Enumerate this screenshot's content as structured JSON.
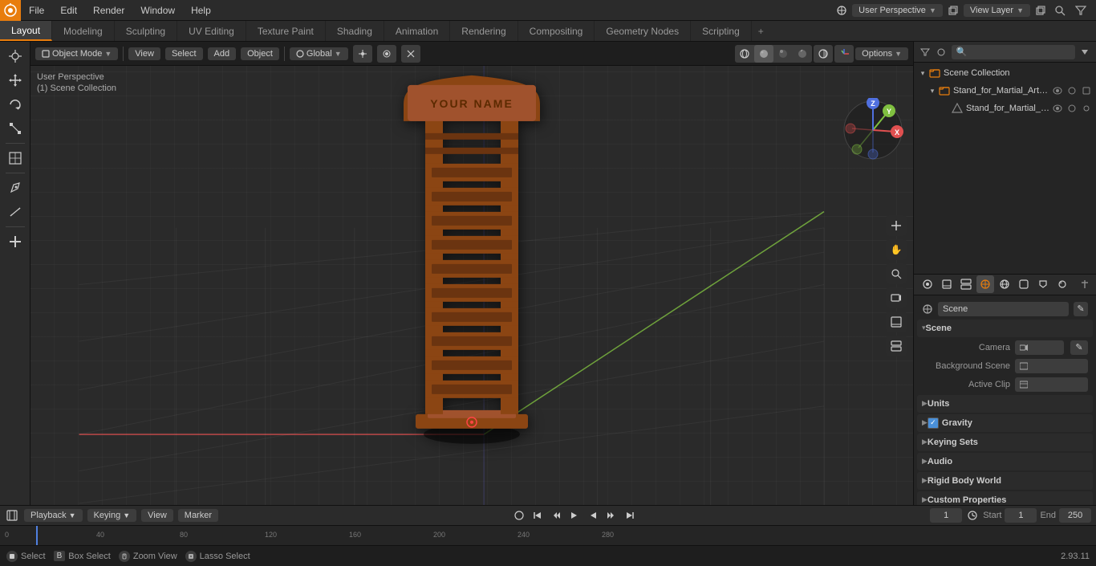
{
  "app": {
    "title": "Blender",
    "version": "2.93.11"
  },
  "top_menu": {
    "logo": "B",
    "items": [
      "File",
      "Edit",
      "Render",
      "Window",
      "Help"
    ]
  },
  "workspace_tabs": {
    "tabs": [
      "Layout",
      "Modeling",
      "Sculpting",
      "UV Editing",
      "Texture Paint",
      "Shading",
      "Animation",
      "Rendering",
      "Compositing",
      "Geometry Nodes",
      "Scripting"
    ],
    "active": "Layout",
    "plus_icon": "+"
  },
  "viewport": {
    "mode_label": "Object Mode",
    "view_label": "View",
    "select_label": "Select",
    "add_label": "Add",
    "object_label": "Object",
    "transform_label": "Global",
    "options_label": "Options",
    "overlay_label": "User Perspective",
    "collection_label": "(1) Scene Collection"
  },
  "scene_object": {
    "name": "Stand_for_Martial_Art_Belts",
    "text": "YOUR NAME"
  },
  "outliner": {
    "title": "Scene Collection",
    "search_placeholder": "",
    "items": [
      {
        "name": "Scene Collection",
        "type": "collection",
        "icon": "📁",
        "expanded": true,
        "depth": 0,
        "has_expand": true
      },
      {
        "name": "Stand_for_Martial_Art_Belts_C",
        "type": "mesh",
        "icon": "▷",
        "expanded": true,
        "depth": 1,
        "has_expand": true,
        "selected": false
      },
      {
        "name": "Stand_for_Martial_Art_Be",
        "type": "object",
        "icon": "△",
        "expanded": false,
        "depth": 2,
        "has_expand": false,
        "selected": false
      }
    ]
  },
  "properties": {
    "title": "Scene",
    "scene_name": "Scene",
    "section_scene": {
      "title": "Scene",
      "expanded": true,
      "fields": {
        "camera_label": "Camera",
        "background_scene_label": "Background Scene",
        "active_clip_label": "Active Clip"
      }
    },
    "section_units": {
      "title": "Units",
      "expanded": false
    },
    "section_gravity": {
      "title": "Gravity",
      "expanded": false,
      "checked": true
    },
    "section_keying_sets": {
      "title": "Keying Sets",
      "expanded": false
    },
    "section_audio": {
      "title": "Audio",
      "expanded": false
    },
    "section_rigid_body_world": {
      "title": "Rigid Body World",
      "expanded": false
    },
    "section_custom_properties": {
      "title": "Custom Properties",
      "expanded": false
    },
    "icons": [
      "render",
      "output",
      "view_layer",
      "scene",
      "world",
      "object",
      "modifier",
      "particles",
      "physics",
      "constraints",
      "data",
      "material",
      "shaderfx"
    ]
  },
  "timeline": {
    "playback_label": "Playback",
    "keying_label": "Keying",
    "view_label": "View",
    "marker_label": "Marker",
    "current_frame": "1",
    "start_label": "Start",
    "start_frame": "1",
    "end_label": "End",
    "end_frame": "250",
    "ruler_marks": [
      "0",
      "40",
      "80",
      "120",
      "160",
      "200",
      "240",
      "280"
    ],
    "ruler_values": [
      0,
      40,
      80,
      120,
      160,
      200,
      240,
      280
    ]
  },
  "status_bar": {
    "select_label": "Select",
    "box_select_label": "Box Select",
    "zoom_view_label": "Zoom View",
    "lasso_select_label": "Lasso Select",
    "version": "2.93.11"
  },
  "tools": {
    "left": [
      {
        "name": "cursor",
        "icon": "⊕",
        "active": false
      },
      {
        "name": "move",
        "icon": "✛",
        "active": false
      },
      {
        "name": "rotate",
        "icon": "↻",
        "active": false
      },
      {
        "name": "scale",
        "icon": "⤡",
        "active": false
      },
      {
        "name": "transform",
        "icon": "⊞",
        "active": false
      },
      {
        "name": "annotate",
        "icon": "✏",
        "active": false
      },
      {
        "name": "measure",
        "icon": "📐",
        "active": false
      },
      {
        "name": "add-cube",
        "icon": "⬜",
        "active": false
      }
    ],
    "right": [
      {
        "name": "pan",
        "icon": "✋",
        "active": false
      },
      {
        "name": "orbit",
        "icon": "↻",
        "active": false
      },
      {
        "name": "camera",
        "icon": "📷",
        "active": false
      },
      {
        "name": "render",
        "icon": "🎬",
        "active": false
      },
      {
        "name": "scene-props",
        "icon": "⚙",
        "active": false
      }
    ]
  }
}
